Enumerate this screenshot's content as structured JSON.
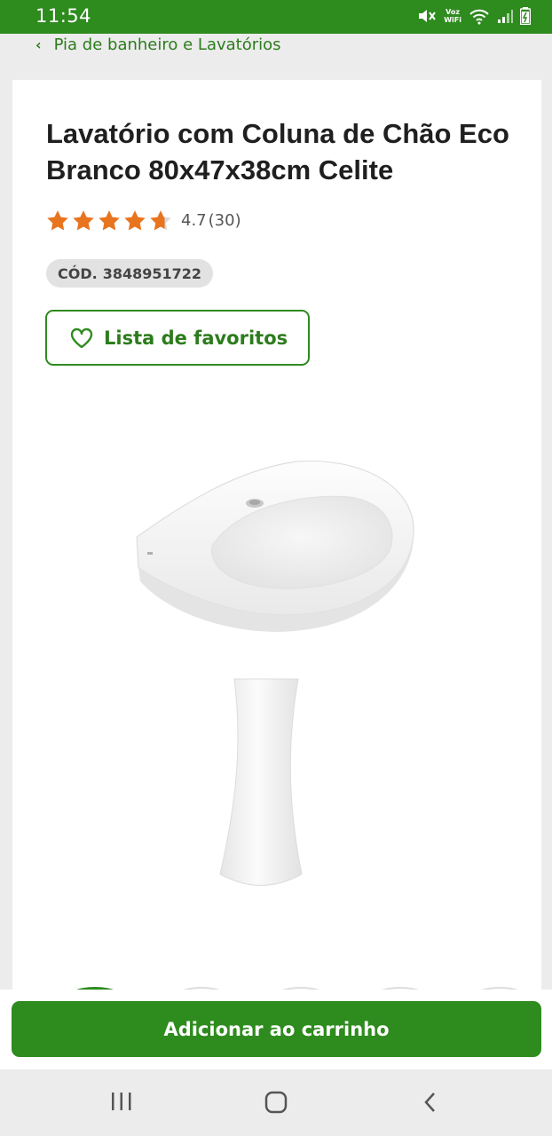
{
  "status_bar": {
    "time": "11:54",
    "voz_line1": "Voz",
    "voz_line2": "WiFi"
  },
  "breadcrumb": {
    "label": "Pia de banheiro e Lavatórios"
  },
  "product": {
    "title": "Lavatório com Coluna de Chão Eco Branco 80x47x38cm Celite",
    "rating_value": "4.7",
    "rating_count": "(30)",
    "stars_filled": 4.7,
    "stars_max": 5,
    "sku_prefix": "CÓD.",
    "sku_code": "3848951722"
  },
  "favorites": {
    "label": "Lista de favoritos"
  },
  "cart": {
    "button_label": "Adicionar ao carrinho"
  },
  "colors": {
    "brand_green": "#2e8b1e",
    "star_orange": "#e8741e"
  }
}
